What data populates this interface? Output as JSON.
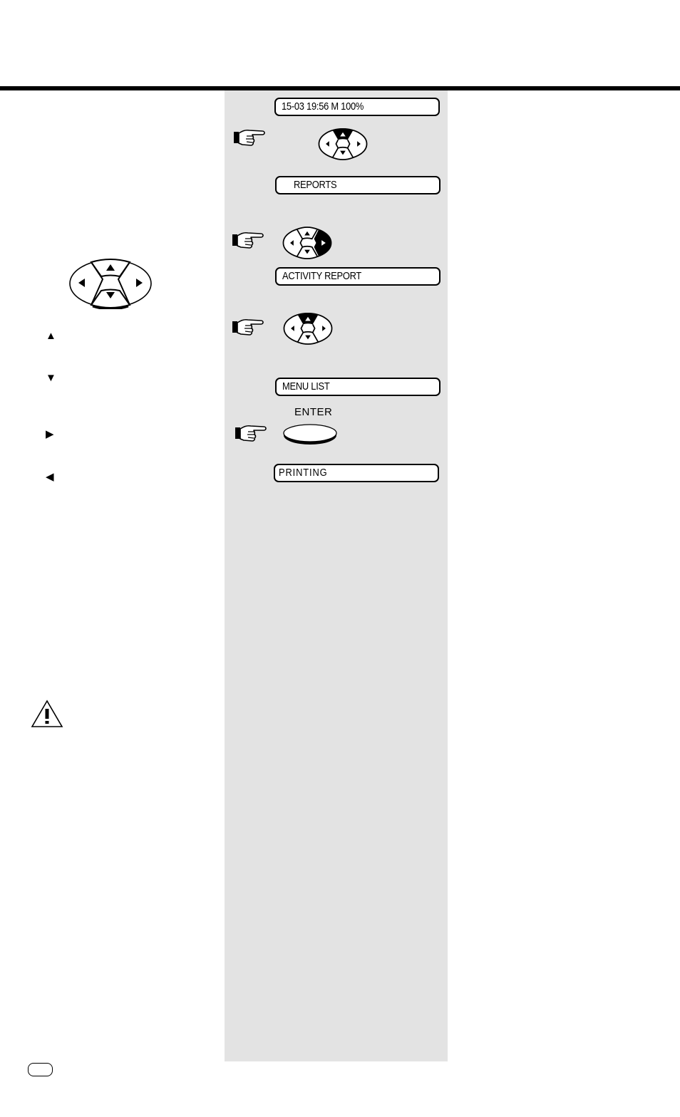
{
  "panel": {
    "background": "#e3e3e3",
    "steps": [
      {
        "display": "15-03 19:56  M 100%"
      },
      {
        "action": "press-up",
        "key_highlight": "up"
      },
      {
        "display": "REPORTS"
      },
      {
        "action": "press-right",
        "key_highlight": "right"
      },
      {
        "display": "ACTIVITY REPORT"
      },
      {
        "action": "press-up",
        "key_highlight": "up"
      },
      {
        "display": "MENU LIST"
      },
      {
        "action": "press-enter",
        "button_label": "ENTER"
      },
      {
        "display": "PRINTING"
      }
    ]
  },
  "left": {
    "navigation_key_icon": "four-way-navigation-key",
    "arrow_legend": [
      {
        "icon": "up-arrow-icon",
        "glyph": "▲"
      },
      {
        "icon": "down-arrow-icon",
        "glyph": "▼"
      },
      {
        "icon": "right-arrow-icon",
        "glyph": "▶"
      },
      {
        "icon": "left-arrow-icon",
        "glyph": "◀"
      }
    ],
    "warning_icon": "warning-triangle-icon"
  },
  "footer": {
    "page_badge_icon": "language-badge"
  }
}
